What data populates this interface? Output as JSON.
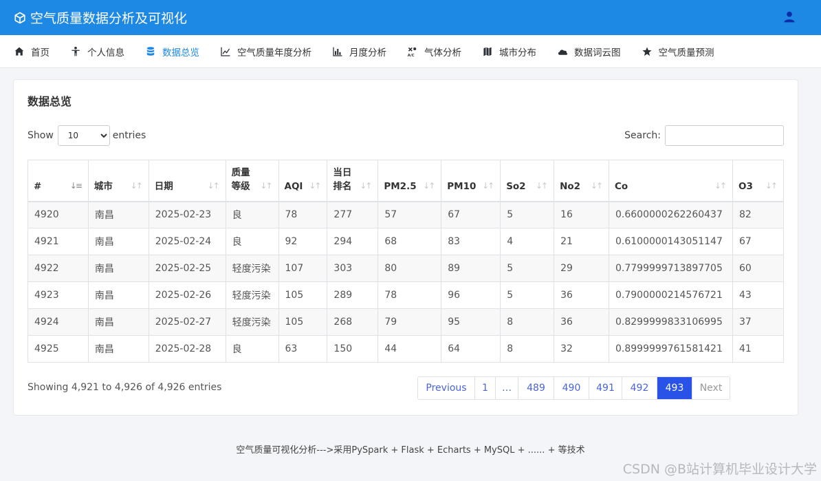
{
  "header": {
    "title": "空气质量数据分析及可视化",
    "accent": "#1e88e5"
  },
  "nav": {
    "items": [
      {
        "label": "首页",
        "icon": "home-icon",
        "active": false
      },
      {
        "label": "个人信息",
        "icon": "person-icon",
        "active": false
      },
      {
        "label": "数据总览",
        "icon": "database-icon",
        "active": true
      },
      {
        "label": "空气质量年度分析",
        "icon": "line-chart-icon",
        "active": false
      },
      {
        "label": "月度分析",
        "icon": "bar-chart-icon",
        "active": false
      },
      {
        "label": "气体分析",
        "icon": "air-icon",
        "active": false
      },
      {
        "label": "城市分布",
        "icon": "map-icon",
        "active": false
      },
      {
        "label": "数据词云图",
        "icon": "cloud-icon",
        "active": false
      },
      {
        "label": "空气质量预测",
        "icon": "star-icon",
        "active": false
      }
    ]
  },
  "card": {
    "title": "数据总览",
    "show_label": "Show",
    "entries_label": "entries",
    "page_length": "10",
    "search_label": "Search:",
    "search_value": ""
  },
  "table": {
    "headers": [
      "#",
      "城市",
      "日期",
      "质量\n等级",
      "AQI",
      "当日\n排名",
      "PM2.5",
      "PM10",
      "So2",
      "No2",
      "Co",
      "O3"
    ],
    "rows": [
      [
        "4920",
        "南昌",
        "2025-02-23",
        "良",
        "78",
        "277",
        "57",
        "67",
        "5",
        "16",
        "0.6600000262260437",
        "82"
      ],
      [
        "4921",
        "南昌",
        "2025-02-24",
        "良",
        "92",
        "294",
        "68",
        "83",
        "4",
        "21",
        "0.6100000143051147",
        "67"
      ],
      [
        "4922",
        "南昌",
        "2025-02-25",
        "轻度污染",
        "107",
        "303",
        "80",
        "89",
        "5",
        "29",
        "0.7799999713897705",
        "60"
      ],
      [
        "4923",
        "南昌",
        "2025-02-26",
        "轻度污染",
        "105",
        "289",
        "78",
        "96",
        "5",
        "36",
        "0.7900000214576721",
        "43"
      ],
      [
        "4924",
        "南昌",
        "2025-02-27",
        "轻度污染",
        "105",
        "268",
        "79",
        "95",
        "8",
        "36",
        "0.8299999833106995",
        "37"
      ],
      [
        "4925",
        "南昌",
        "2025-02-28",
        "良",
        "63",
        "150",
        "44",
        "64",
        "8",
        "32",
        "0.8999999761581421",
        "41"
      ]
    ]
  },
  "info": "Showing 4,921 to 4,926 of 4,926 entries",
  "pagination": {
    "items": [
      {
        "label": "Previous",
        "state": "normal"
      },
      {
        "label": "1",
        "state": "normal"
      },
      {
        "label": "…",
        "state": "normal"
      },
      {
        "label": "489",
        "state": "normal"
      },
      {
        "label": "490",
        "state": "normal"
      },
      {
        "label": "491",
        "state": "normal"
      },
      {
        "label": "492",
        "state": "normal"
      },
      {
        "label": "493",
        "state": "active"
      },
      {
        "label": "Next",
        "state": "disabled"
      }
    ]
  },
  "footer": "空气质量可视化分析--->采用PySpark + Flask + Echarts + MySQL + ...... + 等技术",
  "watermark": "CSDN @B站计算机毕业设计大学"
}
